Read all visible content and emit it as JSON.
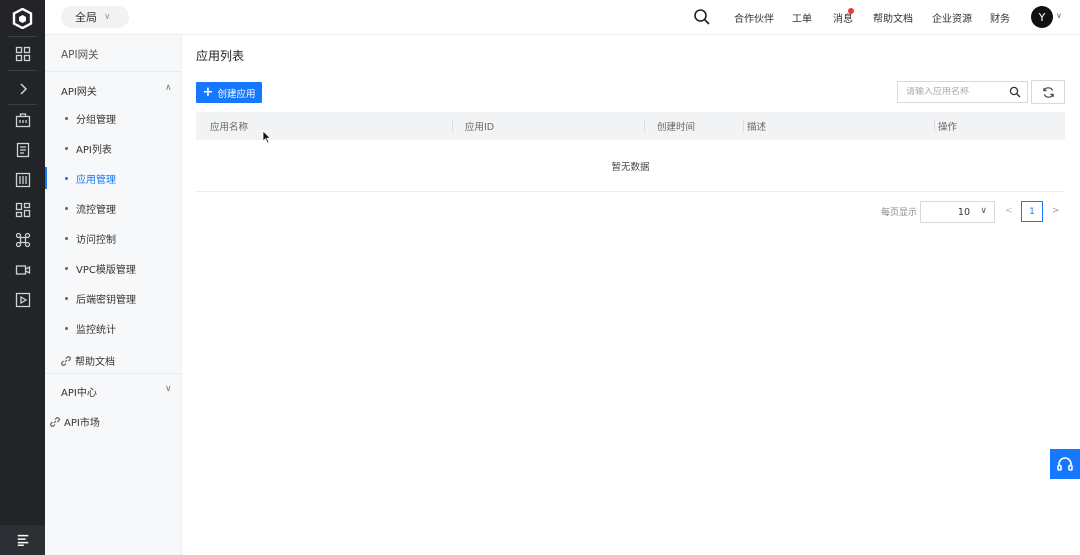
{
  "topbar": {
    "scope": "全局",
    "nav": [
      "合作伙伴",
      "工单",
      "消息",
      "帮助文档",
      "企业资源",
      "财务"
    ],
    "avatar": "Y"
  },
  "sidebar": {
    "title": "API网关",
    "group_gateway": "API网关",
    "items": [
      {
        "label": "分组管理"
      },
      {
        "label": "API列表"
      },
      {
        "label": "应用管理",
        "active": true
      },
      {
        "label": "流控管理"
      },
      {
        "label": "访问控制"
      },
      {
        "label": "VPC模版管理"
      },
      {
        "label": "后端密钥管理"
      },
      {
        "label": "监控统计"
      }
    ],
    "help_doc": "帮助文档",
    "group_center": "API中心",
    "api_market": "API市场"
  },
  "main": {
    "title": "应用列表",
    "create_button": "创建应用",
    "search_placeholder": "请输入应用名称",
    "columns": [
      "应用名称",
      "应用ID",
      "创建时间",
      "描述",
      "操作"
    ],
    "empty_text": "暂无数据",
    "pagination": {
      "page_size_label": "每页显示",
      "page_size": "10",
      "current_page": "1",
      "prev": "<",
      "next": ">"
    }
  },
  "colors": {
    "accent": "#1677ff",
    "rail": "#222428",
    "sidebar_bg": "#f7f8fa",
    "badge": "#e83b2e"
  }
}
